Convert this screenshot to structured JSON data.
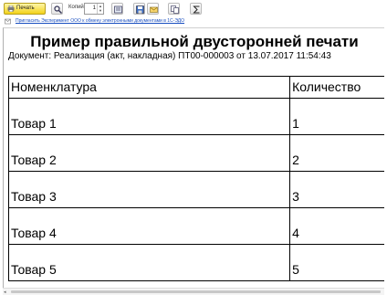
{
  "toolbar": {
    "print_label": "Печать",
    "copies_label": "Копий:",
    "copies_value": "1"
  },
  "invite_link": "Пригласить Эксперимент ООО к обмену электронными документами в 1С-ЭДО",
  "document": {
    "title": "Пример правильной двусторонней печати",
    "subtitle": "Документ: Реализация (акт, накладная) ПТ00-000003 от 13.07.2017 11:54:43",
    "columns": [
      "Номенклатура",
      "Количество"
    ],
    "rows": [
      {
        "name": "Товар 1",
        "qty": "1"
      },
      {
        "name": "Товар 2",
        "qty": "2"
      },
      {
        "name": "Товар 3",
        "qty": "3"
      },
      {
        "name": "Товар 4",
        "qty": "4"
      },
      {
        "name": "Товар 5",
        "qty": "5"
      }
    ]
  },
  "colors": {
    "print_button": "#f2d21a",
    "link": "#1a4fc0"
  }
}
